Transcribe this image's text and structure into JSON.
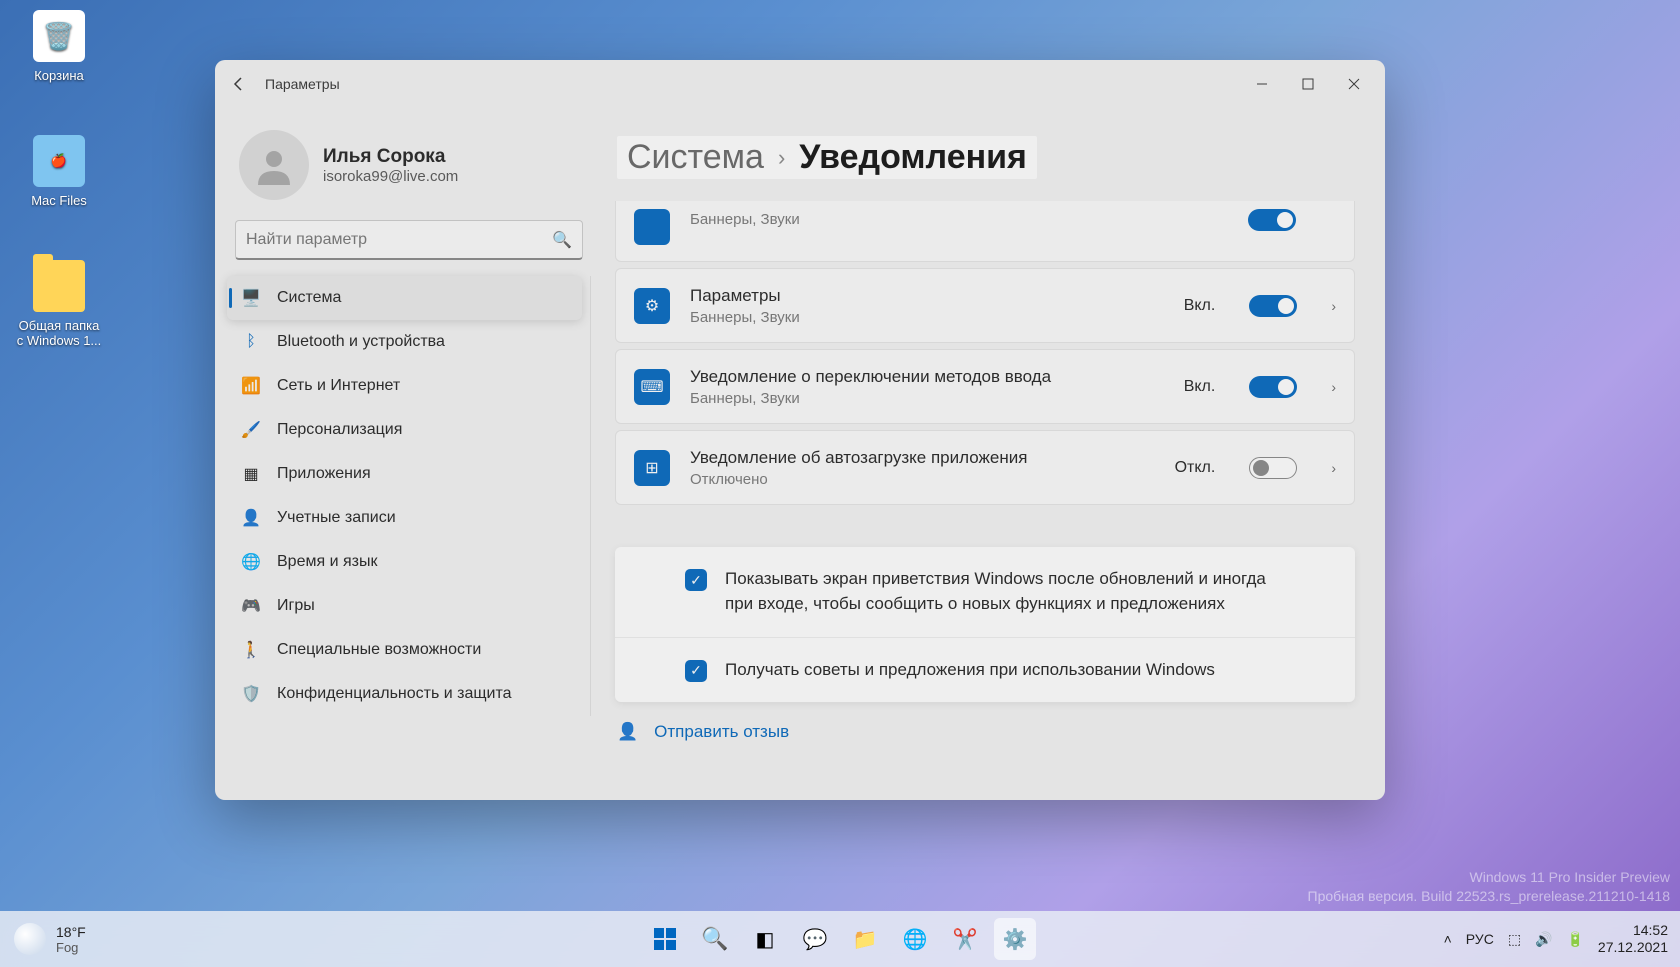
{
  "desktop": {
    "recycle_bin": "Корзина",
    "mac_files": "Mac Files",
    "shared_folder": "Общая папка с Windows 1..."
  },
  "watermark": {
    "line1": "Windows 11 Pro Insider Preview",
    "line2": "Пробная версия. Build 22523.rs_prerelease.211210-1418"
  },
  "window": {
    "title": "Параметры",
    "profile_name": "Илья Сорока",
    "profile_email": "isoroka99@live.com",
    "search_placeholder": "Найти параметр"
  },
  "sidebar": [
    {
      "label": "Система",
      "active": true
    },
    {
      "label": "Bluetooth и устройства"
    },
    {
      "label": "Сеть и Интернет"
    },
    {
      "label": "Персонализация"
    },
    {
      "label": "Приложения"
    },
    {
      "label": "Учетные записи"
    },
    {
      "label": "Время и язык"
    },
    {
      "label": "Игры"
    },
    {
      "label": "Специальные возможности"
    },
    {
      "label": "Конфиденциальность и защита"
    }
  ],
  "breadcrumb": {
    "root": "Система",
    "current": "Уведомления"
  },
  "cards": {
    "c0_sub": "Баннеры, Звуки",
    "c1_title": "Параметры",
    "c1_sub": "Баннеры, Звуки",
    "c1_state": "Вкл.",
    "c2_title": "Уведомление о переключении методов ввода",
    "c2_sub": "Баннеры, Звуки",
    "c2_state": "Вкл.",
    "c3_title": "Уведомление об автозагрузке приложения",
    "c3_sub": "Отключено",
    "c3_state": "Откл."
  },
  "checks": {
    "c1": "Показывать экран приветствия Windows после обновлений и иногда при входе, чтобы сообщить о новых функциях и предложениях",
    "c2": "Получать советы и предложения при использовании Windows"
  },
  "feedback": "Отправить отзыв",
  "taskbar": {
    "temp": "18°F",
    "cond": "Fog",
    "lang": "РУС",
    "time": "14:52",
    "date": "27.12.2021"
  }
}
